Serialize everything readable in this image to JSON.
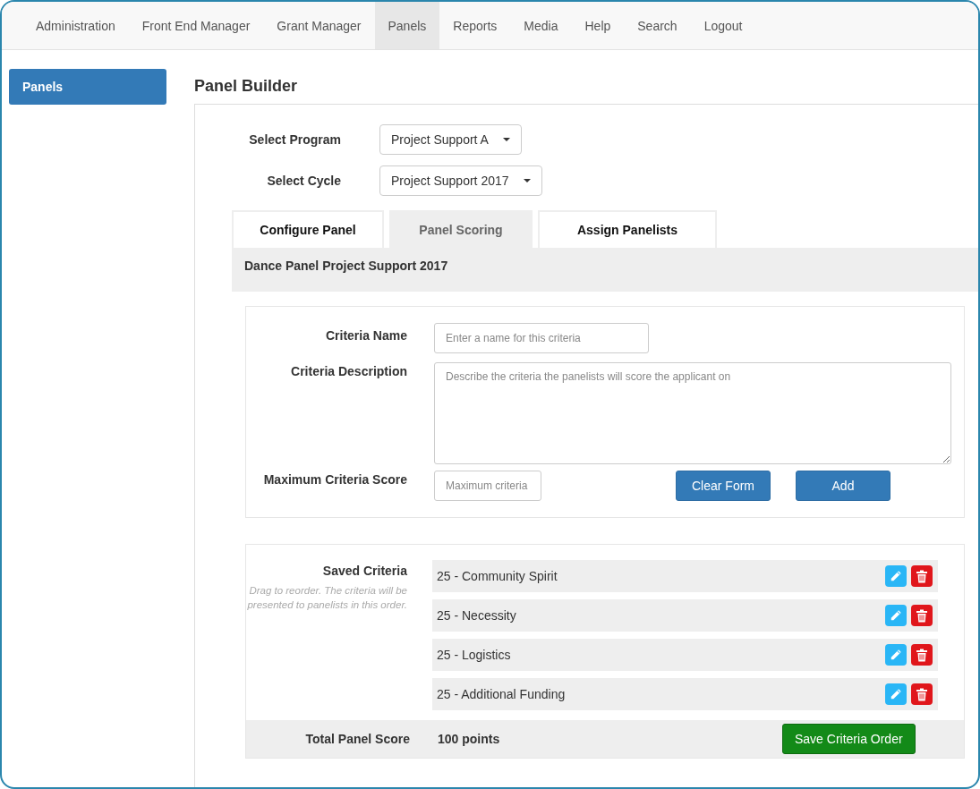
{
  "nav": {
    "items": [
      {
        "label": "Administration",
        "selected": false
      },
      {
        "label": "Front End Manager",
        "selected": false
      },
      {
        "label": "Grant Manager",
        "selected": false
      },
      {
        "label": "Panels",
        "selected": true
      },
      {
        "label": "Reports",
        "selected": false
      },
      {
        "label": "Media",
        "selected": false
      },
      {
        "label": "Help",
        "selected": false
      },
      {
        "label": "Search",
        "selected": false
      },
      {
        "label": "Logout",
        "selected": false
      }
    ]
  },
  "sidebar": {
    "items": [
      {
        "label": "Panels",
        "selected": true
      }
    ]
  },
  "page_title": "Panel Builder",
  "selects": [
    {
      "label": "Select Program",
      "value": "Project Support A"
    },
    {
      "label": "Select Cycle",
      "value": "Project Support 2017"
    }
  ],
  "tabs": [
    {
      "label": "Configure Panel",
      "selected": false
    },
    {
      "label": "Panel Scoring",
      "selected": true
    },
    {
      "label": "Assign Panelists",
      "selected": false
    }
  ],
  "panel_heading": "Dance Panel Project Support 2017",
  "form": {
    "name_label": "Criteria Name",
    "name_placeholder": "Enter a name for this criteria",
    "description_label": "Criteria Description",
    "description_placeholder": "Describe the criteria the panelists will score the applicant on",
    "max_label": "Maximum Criteria Score",
    "max_placeholder": "Maximum criteria",
    "buttons": [
      "Clear Form",
      "Add"
    ]
  },
  "saved": {
    "label": "Saved Criteria",
    "hint": "Drag to reorder. The criteria will be presented to panelists in this order.",
    "items": [
      "25 - Community Spirit",
      "25 - Necessity",
      "25 - Logistics",
      "25 - Additional Funding"
    ]
  },
  "total": {
    "label": "Total Panel Score",
    "value": "100 points",
    "button": "Save Criteria Order"
  }
}
